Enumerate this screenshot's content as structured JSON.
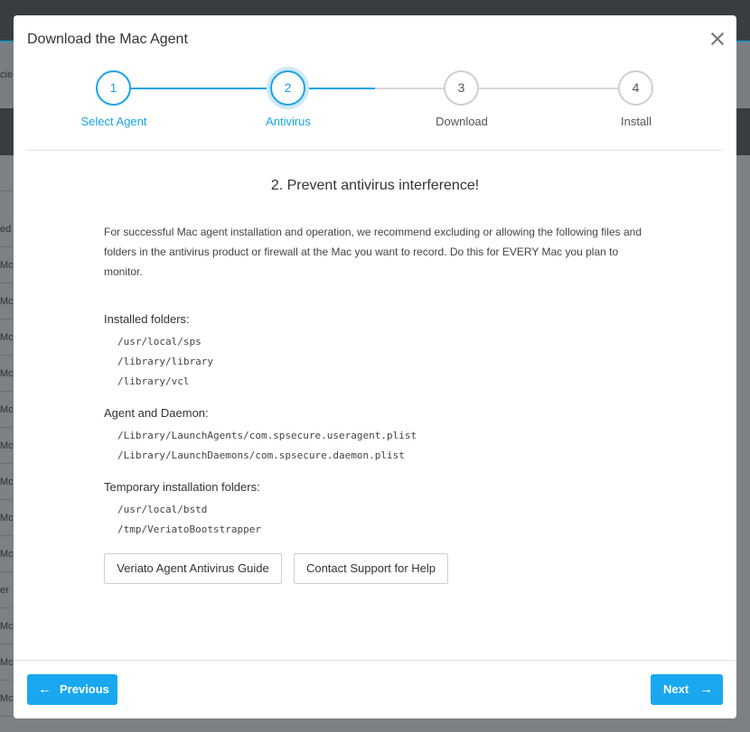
{
  "background": {
    "rows": [
      "",
      "ed",
      "Mo",
      "Mo",
      "Mo",
      "Mo",
      "Mo",
      "Mo",
      "Mo",
      "Mo",
      "Mo",
      "er",
      "Mo",
      "Mo",
      "Mo"
    ],
    "tab_stub": "cie"
  },
  "modal": {
    "title": "Download the Mac Agent"
  },
  "stepper": {
    "steps": [
      {
        "number": "1",
        "label": "Select Agent",
        "state": "done"
      },
      {
        "number": "2",
        "label": "Antivirus",
        "state": "current"
      },
      {
        "number": "3",
        "label": "Download",
        "state": "pending"
      },
      {
        "number": "4",
        "label": "Install",
        "state": "pending"
      }
    ]
  },
  "content": {
    "heading": "2. Prevent antivirus interference!",
    "intro": "For successful Mac agent installation and operation, we recommend excluding or allowing the following files and folders in the antivirus product or firewall at the Mac you want to record. Do this for EVERY Mac you plan to monitor.",
    "sections": [
      {
        "title": "Installed folders:",
        "paths": [
          "/usr/local/sps",
          "/library/library",
          "/library/vcl"
        ]
      },
      {
        "title": "Agent and Daemon:",
        "paths": [
          "/Library/LaunchAgents/com.spsecure.useragent.plist",
          "/Library/LaunchDaemons/com.spsecure.daemon.plist"
        ]
      },
      {
        "title": "Temporary installation folders:",
        "paths": [
          "/usr/local/bstd",
          "/tmp/VeriatoBootstrapper"
        ]
      }
    ],
    "guide_button": "Veriato Agent Antivirus Guide",
    "support_button": "Contact Support for Help"
  },
  "footer": {
    "previous_label": "Previous",
    "next_label": "Next"
  },
  "colors": {
    "accent": "#1aa3e8",
    "primary_button": "#19a8f0"
  }
}
